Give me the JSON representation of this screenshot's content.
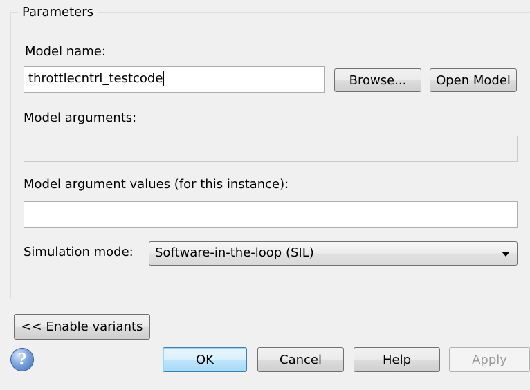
{
  "parameters": {
    "title": "Parameters",
    "model_name_label": "Model name:",
    "model_name_value": "throttlecntrl_testcode",
    "browse_label": "Browse...",
    "open_model_label": "Open Model",
    "model_arguments_label": "Model arguments:",
    "model_arguments_value": "",
    "model_argument_values_label": "Model argument values (for this instance):",
    "model_argument_values_value": "",
    "simulation_mode_label": "Simulation mode:",
    "simulation_mode_value": "Software-in-the-loop (SIL)"
  },
  "variants_button_label": "<< Enable variants",
  "footer": {
    "help_icon": "question-mark",
    "ok_label": "OK",
    "cancel_label": "Cancel",
    "help_label": "Help",
    "apply_label": "Apply"
  },
  "colors": {
    "default_button_border": "#3c7fb1",
    "disabled_text": "#9a9a9a"
  }
}
